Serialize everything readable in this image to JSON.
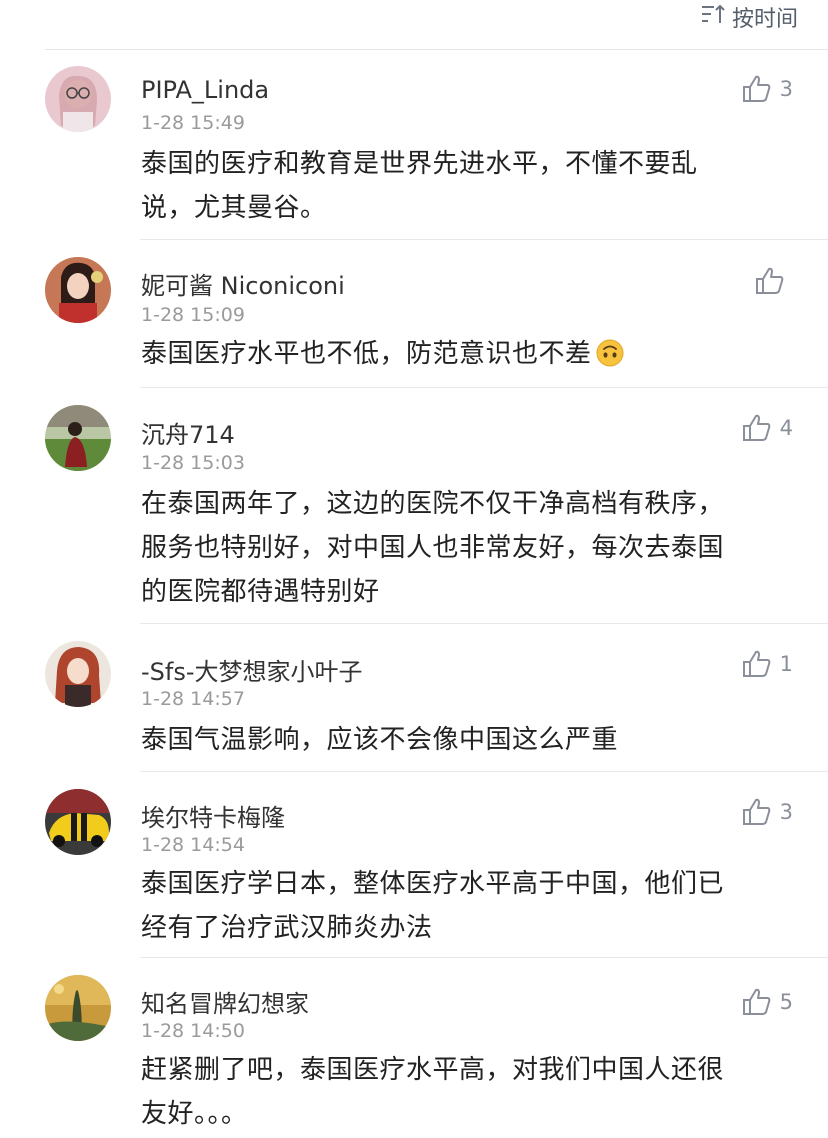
{
  "sort": {
    "label": "按时间"
  },
  "comments": [
    {
      "username": "PIPA_Linda",
      "time": "1-28 15:49",
      "line1": "泰国的医疗和教育是世界先进水平，不懂不要乱",
      "line2": "说，尤其曼谷。",
      "line3": "",
      "likes": "3",
      "avatar_icon": "avatar-woman-glasses"
    },
    {
      "username": "妮可酱 Niconiconi",
      "time": "1-28 15:09",
      "line1": "泰国医疗水平也不低，防范意识也不差",
      "line2": "",
      "line3": "",
      "likes": "",
      "emoji": "upside-down-face",
      "avatar_icon": "avatar-woman-red"
    },
    {
      "username": "沉舟714",
      "time": "1-28 15:03",
      "line1": "在泰国两年了，这边的医院不仅干净高档有秩序，",
      "line2": "服务也特别好，对中国人也非常友好，每次去泰国",
      "line3": "的医院都待遇特别好",
      "likes": "4",
      "avatar_icon": "avatar-field-person"
    },
    {
      "username": "-Sfs-大梦想家小叶子",
      "time": "1-28 14:57",
      "line1": "泰国气温影响，应该不会像中国这么严重",
      "line2": "",
      "line3": "",
      "likes": "1",
      "avatar_icon": "avatar-anime-girl"
    },
    {
      "username": "埃尔特卡梅隆",
      "time": "1-28 14:54",
      "line1": "泰国医疗学日本，整体医疗水平高于中国，他们已",
      "line2": "经有了治疗武汉肺炎办法",
      "line3": "",
      "likes": "3",
      "avatar_icon": "avatar-yellow-car"
    },
    {
      "username": "知名冒牌幻想家",
      "time": "1-28 14:50",
      "line1": "赶紧删了吧，泰国医疗水平高，对我们中国人还很",
      "line2": "友好。。。",
      "line3": "",
      "likes": "5",
      "avatar_icon": "avatar-painting"
    }
  ],
  "colors": {
    "text": "#222222",
    "meta": "#9a9a9a",
    "icon": "#8a8f99",
    "divider": "#e8e8e8"
  }
}
